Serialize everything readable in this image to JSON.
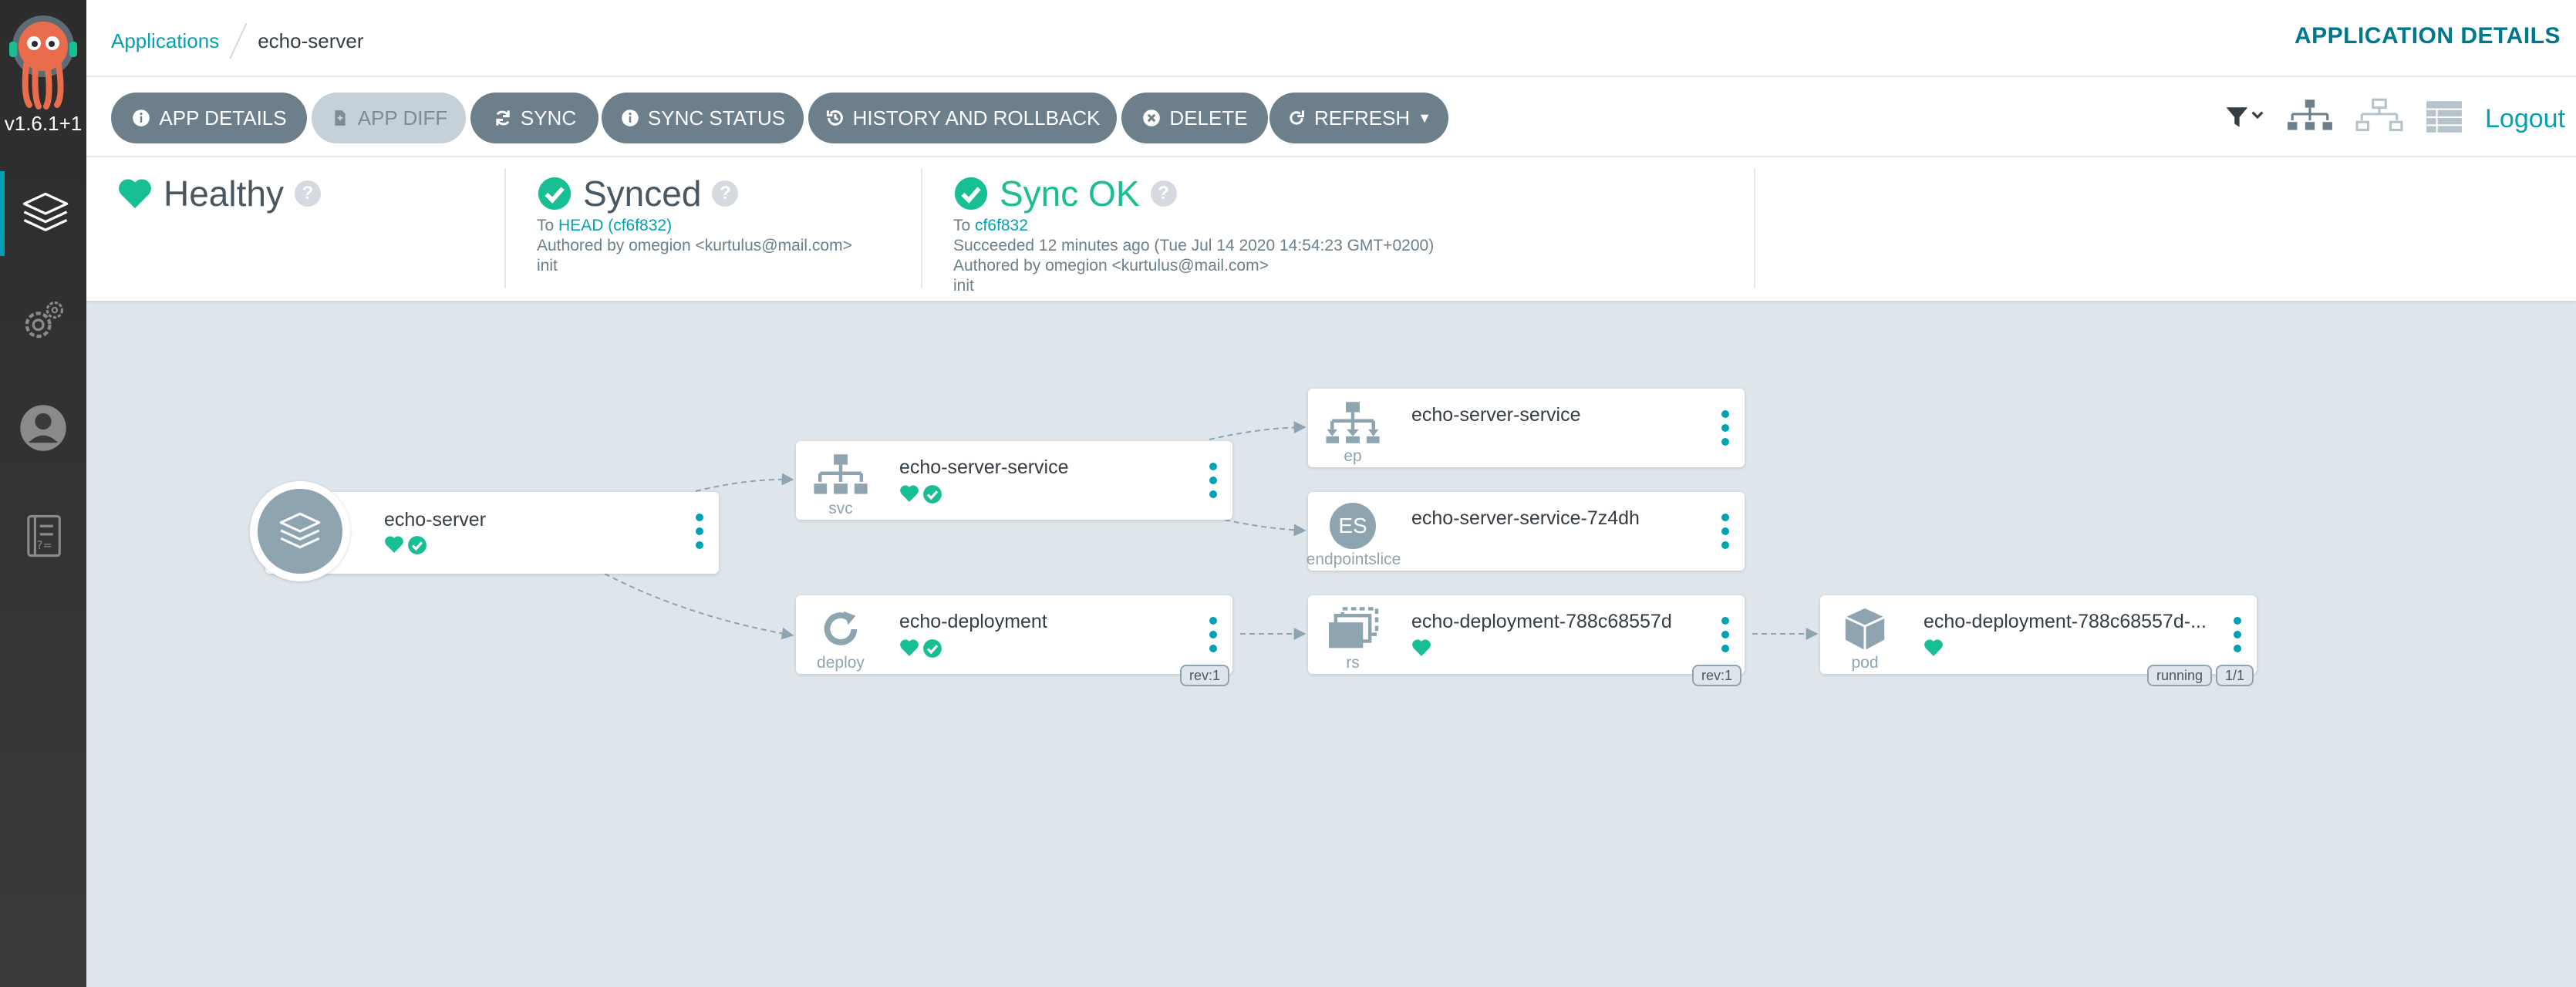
{
  "sidebar": {
    "version": "v1.6.1+1",
    "items": [
      {
        "name": "applications"
      },
      {
        "name": "settings"
      },
      {
        "name": "user-info"
      },
      {
        "name": "documentation"
      }
    ]
  },
  "breadcrumb": {
    "root": "Applications",
    "current": "echo-server"
  },
  "header": {
    "title": "APPLICATION DETAILS"
  },
  "toolbar": {
    "app_details": "APP DETAILS",
    "app_diff": "APP DIFF",
    "sync": "SYNC",
    "sync_status": "SYNC STATUS",
    "history": "HISTORY AND ROLLBACK",
    "delete": "DELETE",
    "refresh": "REFRESH",
    "logout": "Logout"
  },
  "status": {
    "health": {
      "label": "Healthy"
    },
    "sync": {
      "label": "Synced",
      "to_prefix": "To ",
      "revision": "HEAD (cf6f832)",
      "author": "Authored by omegion <kurtulus@mail.com>",
      "message": "init"
    },
    "operation": {
      "label": "Sync OK",
      "to_prefix": "To ",
      "revision": "cf6f832",
      "succeeded": "Succeeded 12 minutes ago (Tue Jul 14 2020 14:54:23 GMT+0200)",
      "author": "Authored by omegion <kurtulus@mail.com>",
      "message": "init"
    }
  },
  "graph": {
    "nodes": {
      "app": {
        "title": "echo-server"
      },
      "svc": {
        "title": "echo-server-service",
        "kind": "svc"
      },
      "deploy": {
        "title": "echo-deployment",
        "kind": "deploy",
        "tag": "rev:1"
      },
      "ep": {
        "title": "echo-server-service",
        "kind": "ep"
      },
      "eps": {
        "title": "echo-server-service-7z4dh",
        "kind": "endpointslice",
        "badge": "ES"
      },
      "rs": {
        "title": "echo-deployment-788c68557d",
        "kind": "rs",
        "tag": "rev:1"
      },
      "pod": {
        "title": "echo-deployment-788c68557d-...",
        "kind": "pod",
        "tag_status": "running",
        "tag_ready": "1/1"
      }
    }
  },
  "colors": {
    "accent": "#00a2b3",
    "healthy": "#18be94",
    "button": "#6d7f8b",
    "canvas": "#dee6eb"
  }
}
